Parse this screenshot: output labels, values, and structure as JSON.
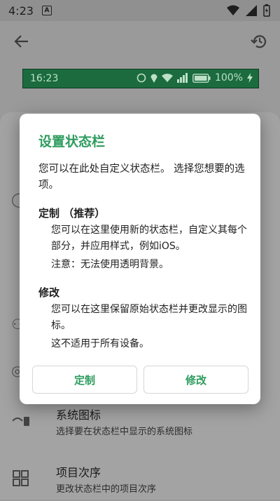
{
  "status_bar": {
    "time": "4:23",
    "notification_icon": "A"
  },
  "app_bar": {
    "back_icon": "arrow-left-icon",
    "history_icon": "restore-icon"
  },
  "preview_bar": {
    "time": "16:23",
    "battery_text": "100%"
  },
  "settings_list": [
    {
      "title": "系统图标",
      "subtitle": "选择要在状态栏中显示的系统图标",
      "icon": "system-icons-icon"
    },
    {
      "title": "项目次序",
      "subtitle": "更改状态栏中的项目次序",
      "icon": "grid-order-icon"
    }
  ],
  "dialog": {
    "title": "设置状态栏",
    "intro": "您可以在此处自定义状态栏。 选择您想要的选项。",
    "custom": {
      "heading": "定制 （推荐）",
      "desc": "您可以在这里使用新的状态栏，自定义其每个部分，并应用样式，例如iOS。",
      "note": "注意：无法使用透明背景。"
    },
    "modify": {
      "heading": "修改",
      "desc": "您可以在这里保留原始状态栏并更改显示的图标。",
      "note": "这不适用于所有设备。"
    },
    "buttons": {
      "custom": "定制",
      "modify": "修改"
    },
    "accent_color": "#2e9c5e"
  }
}
